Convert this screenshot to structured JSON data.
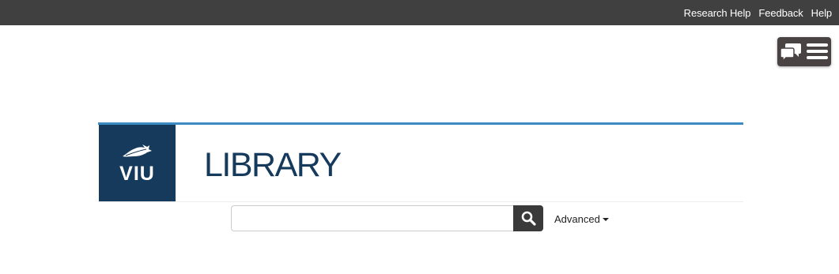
{
  "topnav": {
    "links": [
      "Research Help",
      "Feedback",
      "Help"
    ]
  },
  "chat_widget": {
    "icons": [
      "chat-bubbles-icon",
      "hamburger-menu-icon"
    ]
  },
  "header": {
    "logo_text": "VIU",
    "title": "LIBRARY"
  },
  "search": {
    "value": "",
    "placeholder": "",
    "button_icon": "search-icon",
    "advanced_label": "Advanced"
  },
  "colors": {
    "topbar": "#404040",
    "brand_navy": "#163a5c",
    "accent_blue": "#3d8bc3",
    "search_button": "#3a3a3a"
  }
}
